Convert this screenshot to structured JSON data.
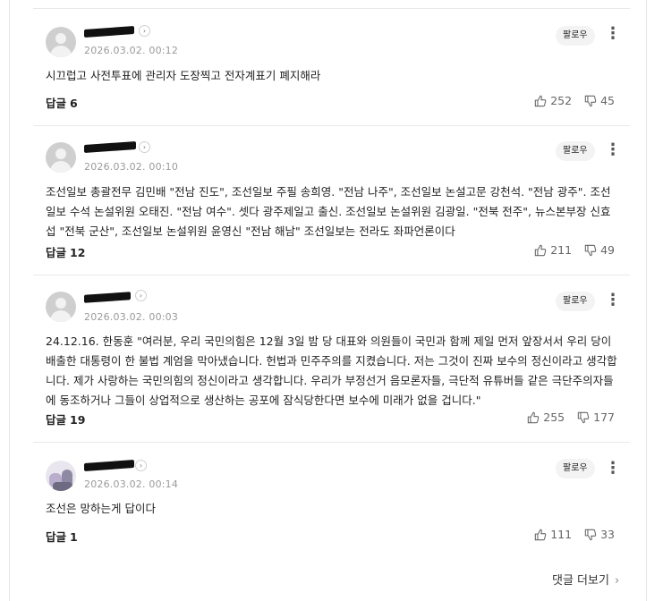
{
  "comments": [
    {
      "date": "2026.03.02. 00:12",
      "follow_label": "팔로우",
      "text": "시끄럽고 사전투표에 관리자 도장찍고 전자계표기 폐지해라",
      "replies_label": "답글",
      "replies_count": "6",
      "likes": "252",
      "dislikes": "45"
    },
    {
      "date": "2026.03.02. 00:10",
      "follow_label": "팔로우",
      "text": "조선일보 총괄전무 김민배 \"전남 진도\", 조선일보 주필 송희영. \"전남 나주\", 조선일보 논설고문 강천석. \"전남 광주\". 조선일보 수석 논설위원 오태진. \"전남 여수\". 셋다 광주제일고 출신. 조선일보 논설위원 김광일. \"전북 전주\", 뉴스본부장 신효섭 \"전북 군산\", 조선일보 논설위원 윤영신 \"전남 해남\" 조선일보는 전라도 좌파언론이다",
      "replies_label": "답글",
      "replies_count": "12",
      "likes": "211",
      "dislikes": "49"
    },
    {
      "date": "2026.03.02. 00:03",
      "follow_label": "팔로우",
      "text": "24.12.16. 한동훈 \"여러분, 우리 국민의힘은 12월 3일 밤 당 대표와 의원들이 국민과 함께 제일 먼저 앞장서서 우리 당이 배출한 대통령이 한 불법 계엄을 막아냈습니다. 헌법과 민주주의를 지켰습니다. 저는 그것이 진짜 보수의 정신이라고 생각합니다. 제가 사랑하는 국민의힘의 정신이라고 생각합니다. 우리가 부정선거 음모론자들, 극단적 유튜버들 같은 극단주의자들에 동조하거나 그들이 상업적으로 생산하는 공포에 잠식당한다면 보수에 미래가 없을 겁니다.\"",
      "replies_label": "답글",
      "replies_count": "19",
      "likes": "255",
      "dislikes": "177"
    },
    {
      "date": "2026.03.02. 00:14",
      "follow_label": "팔로우",
      "text": "조선은 망하는게 답이다",
      "replies_label": "답글",
      "replies_count": "1",
      "likes": "111",
      "dislikes": "33"
    }
  ],
  "more_comments_label": "댓글 더보기",
  "icons": {
    "chevron": "chevron-right-icon",
    "like": "thumbs-up-icon",
    "dislike": "thumbs-down-icon",
    "more": "kebab-menu-icon"
  }
}
